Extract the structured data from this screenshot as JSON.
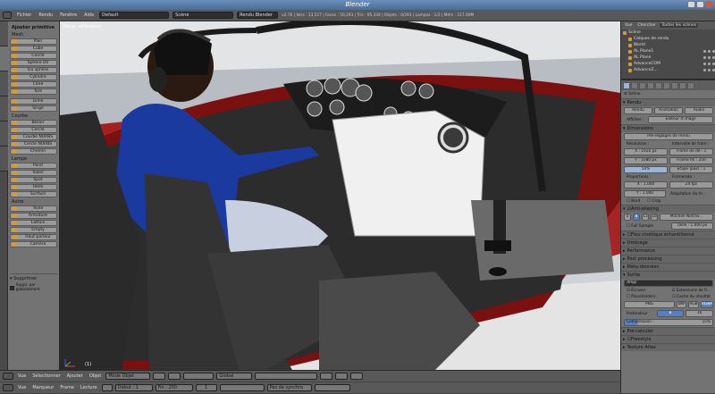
{
  "window": {
    "title": "Blender"
  },
  "menubar": {
    "items": [
      "Fichier",
      "Rendu",
      "Fenêtre",
      "Aide"
    ],
    "layout": "Default",
    "scene": "Scène",
    "engine": "Rendu Blender",
    "stats": "v2.76 | Vers : 13,517 | Faces : 50,193 | Tris : 95,334 | Objets : 0/293 | Lampes : 1/2 | Mém : 117.00M"
  },
  "toolshelf": {
    "title": "Ajouter primitive",
    "sections": [
      {
        "title": "Mesh",
        "items": [
          "Plan",
          "Cube",
          "Cercle",
          "Sphère UV",
          "Ico sphère",
          "Cylindre",
          "Cône",
          "Tore"
        ]
      },
      {
        "title": "",
        "items": [
          "Grille",
          "Singe"
        ]
      },
      {
        "title": "Courbe",
        "items": [
          "Bézier",
          "Cercle",
          "Courbe NURBS",
          "Cercle NURBS",
          "Chemin"
        ]
      },
      {
        "title": "Lampe",
        "items": [
          "Point",
          "Soleil",
          "Spot",
          "Hémi",
          "Surface"
        ]
      },
      {
        "title": "Autre",
        "items": [
          "Texte",
          "Armature",
          "Lattice",
          "Empty",
          "Haut-parleur",
          "Caméra"
        ]
      }
    ],
    "delete_title": "Supprimer",
    "delete_option": "Suppr. par globalement"
  },
  "viewport": {
    "label": "Persp. utilisateur",
    "object_label": "(1)"
  },
  "outliner": {
    "tabs": [
      "Vue",
      "Chercher",
      "Toutes les scènes"
    ],
    "rows": [
      "Scène",
      "Calques de rendu",
      "World",
      "AL Plane1",
      "AL Plane",
      "AdvanceCOM",
      "AdvanceZ..."
    ]
  },
  "properties": {
    "scene_label": "Scène",
    "render_section": "Rendu",
    "render_buttons": [
      "Rendu",
      "Animation",
      "Audio"
    ],
    "display_label": "Afficher :",
    "display_value": "Editeur d'image",
    "dimensions_section": "Dimensions",
    "presets": "Pré-réglages de rendu",
    "resolution_label": "Résolution :",
    "frame_range_label": "Intervalle de fram :",
    "res_x": "X : 1920 px",
    "res_y": "Y : 1080 px",
    "res_pct": "50%",
    "frame_start": "Frame de dé : 1",
    "frame_end": "Frame fin : 250",
    "frame_step": "Étape (pas) : 1",
    "aspect_label": "Proportions :",
    "fps_label": "Framerate :",
    "aspect_x": "X : 1.000",
    "aspect_y": "Y : 1.000",
    "fps": "24 fps",
    "time_remap": "Adaptation du te :",
    "bord": "Bord",
    "crop": "Crop",
    "aa_section": "Anti-aliasing",
    "aa_samples": [
      "5",
      "8",
      "11",
      "16"
    ],
    "aa_filter": "Mitchell-Netrav...",
    "full_sample": "Full Sample",
    "aa_size": "Taille : 1.000 px",
    "collapsed_sections": [
      "Flou cinétique échantillonné",
      "Ombrage",
      "Performance",
      "Post processing",
      "Méta-données"
    ],
    "output_section": "Sortie",
    "output_path": "/tmp/",
    "overwrite": "Écraser",
    "extensions": "Extensions de fi...",
    "placeholders": "Placeholders",
    "cache_result": "Cache du résultat",
    "format": "PNG",
    "color_modes": [
      "BW",
      "RGB",
      "RGBA"
    ],
    "depth_label": "Profondeur",
    "depth_values": [
      "8",
      "16"
    ],
    "compression_label": "Compression :",
    "compression_value": "15%",
    "bottom_sections": [
      "Pré-calculer",
      "Freestyle",
      "Texture Atlas"
    ]
  },
  "bottombar": {
    "row1": [
      "Vue",
      "Sélectionner",
      "Ajouter",
      "Objet",
      "Mode Objet",
      "Global"
    ],
    "row2": [
      "Vue",
      "Marqueur",
      "Frame",
      "Lecture"
    ],
    "start": "Début : 1",
    "end": "Fin : 250",
    "current": "1",
    "sync": "Pas de synchro"
  }
}
